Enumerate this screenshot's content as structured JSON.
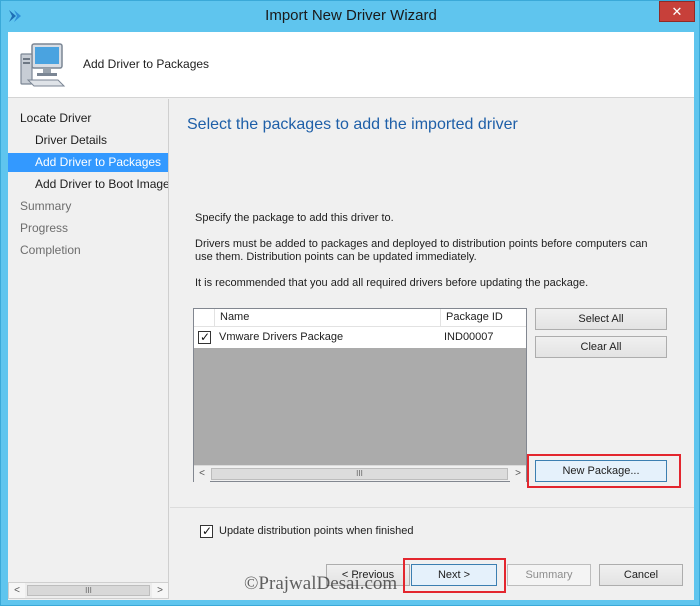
{
  "window": {
    "title": "Import New Driver Wizard",
    "close_glyph": "✕",
    "app_icon": "wizard-arrow-icon"
  },
  "header": {
    "icon": "computer-icon",
    "text": "Add Driver to Packages"
  },
  "nav": {
    "items": [
      {
        "label": "Locate Driver",
        "level": 0,
        "state": "normal"
      },
      {
        "label": "Driver Details",
        "level": 1,
        "state": "normal"
      },
      {
        "label": "Add Driver to Packages",
        "level": 1,
        "state": "active"
      },
      {
        "label": "Add Driver to Boot Image",
        "level": 1,
        "state": "normal"
      },
      {
        "label": "Summary",
        "level": 0,
        "state": "dim"
      },
      {
        "label": "Progress",
        "level": 0,
        "state": "dim"
      },
      {
        "label": "Completion",
        "level": 0,
        "state": "dim"
      }
    ],
    "scroll_left": "<",
    "scroll_right": ">",
    "scroll_thumb": "III"
  },
  "main": {
    "heading": "Select the packages to add the imported driver",
    "para1": "Specify the package to add this driver to.",
    "para2": "Drivers must be added to packages and deployed to distribution points before computers can use them.  Distribution points can be updated immediately.",
    "para3": "It is recommended that you add all required drivers before updating the package."
  },
  "packages": {
    "columns": [
      "Name",
      "Package ID"
    ],
    "rows": [
      {
        "checked": true,
        "name": "Vmware Drivers Package",
        "id": "IND00007"
      }
    ],
    "scroll_left": "<",
    "scroll_right": ">",
    "scroll_thumb": "III"
  },
  "buttons": {
    "select_all": "Select All",
    "clear_all": "Clear All",
    "new_package": "New Package...",
    "previous": "< Previous",
    "next": "Next >",
    "summary": "Summary",
    "cancel": "Cancel"
  },
  "update_dp": {
    "checked": true,
    "label": "Update distribution points when finished"
  },
  "watermark": "©PrajwalDesai.com",
  "colors": {
    "title_bar": "#5fc5ee",
    "selection": "#3399ff",
    "heading": "#1e5fa8",
    "annotation_box": "#e3262e"
  }
}
